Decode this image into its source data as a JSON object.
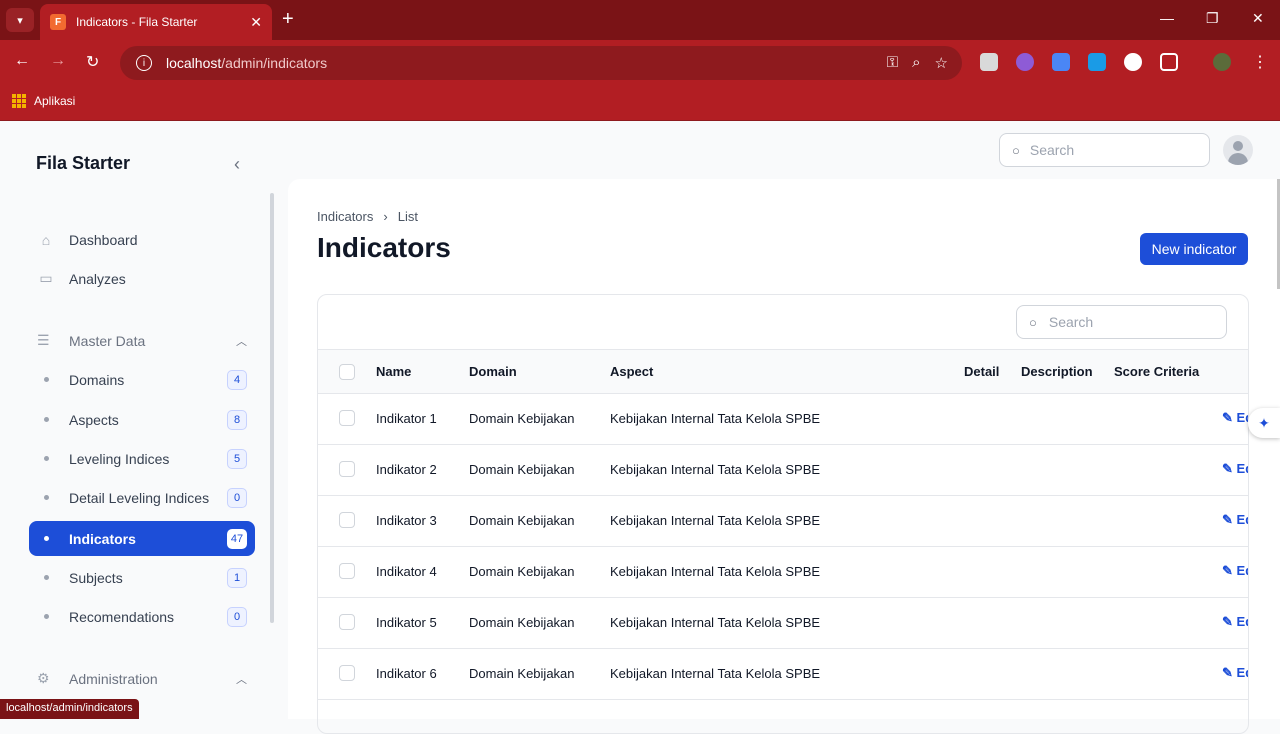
{
  "browser": {
    "tab_title": "Indicators - Fila Starter",
    "favicon": "F",
    "url_host": "localhost",
    "url_path": "/admin/indicators",
    "bookmark_label": "Aplikasi",
    "status_url": "localhost/admin/indicators"
  },
  "app": {
    "brand": "Fila Starter",
    "search_placeholder": "Search"
  },
  "sidebar": {
    "dashboard": "Dashboard",
    "analyzes": "Analyzes",
    "master_data": "Master Data",
    "administration": "Administration",
    "items": [
      {
        "label": "Domains",
        "count": "4"
      },
      {
        "label": "Aspects",
        "count": "8"
      },
      {
        "label": "Leveling Indices",
        "count": "5"
      },
      {
        "label": "Detail Leveling Indices",
        "count": "0"
      },
      {
        "label": "Indicators",
        "count": "47"
      },
      {
        "label": "Subjects",
        "count": "1"
      },
      {
        "label": "Recomendations",
        "count": "0"
      }
    ]
  },
  "page": {
    "breadcrumb_1": "Indicators",
    "breadcrumb_2": "List",
    "title": "Indicators",
    "new_button": "New indicator",
    "table_search_placeholder": "Search",
    "columns": [
      "Name",
      "Domain",
      "Aspect",
      "Detail",
      "Description",
      "Score Criteria"
    ],
    "edit_label": "Edit",
    "rows": [
      {
        "name": "Indikator 1",
        "domain": "Domain Kebijakan",
        "aspect": "Kebijakan Internal Tata Kelola SPBE"
      },
      {
        "name": "Indikator 2",
        "domain": "Domain Kebijakan",
        "aspect": "Kebijakan Internal Tata Kelola SPBE"
      },
      {
        "name": "Indikator 3",
        "domain": "Domain Kebijakan",
        "aspect": "Kebijakan Internal Tata Kelola SPBE"
      },
      {
        "name": "Indikator 4",
        "domain": "Domain Kebijakan",
        "aspect": "Kebijakan Internal Tata Kelola SPBE"
      },
      {
        "name": "Indikator 5",
        "domain": "Domain Kebijakan",
        "aspect": "Kebijakan Internal Tata Kelola SPBE"
      },
      {
        "name": "Indikator 6",
        "domain": "Domain Kebijakan",
        "aspect": "Kebijakan Internal Tata Kelola SPBE"
      }
    ]
  },
  "colors": {
    "primary": "#1d4ed8",
    "browser_frame": "#b21e23"
  }
}
